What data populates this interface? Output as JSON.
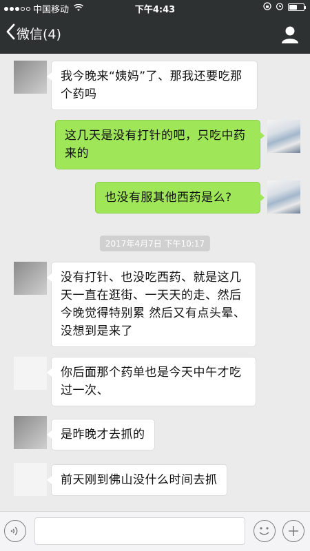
{
  "status_bar": {
    "carrier": "中国移动",
    "time": "下午4:43"
  },
  "nav": {
    "back_label": "微信(4)"
  },
  "messages": [
    {
      "side": "left",
      "avatar": "grey-avatar",
      "text": "我今晚来“姨妈”了、那我还要吃那个药吗"
    },
    {
      "side": "right",
      "text": "这几天是没有打针的吧，只吃中药来的"
    },
    {
      "side": "right",
      "text": "也没有服其他西药是么?"
    },
    {
      "side": "left",
      "avatar": "grey-avatar",
      "text": "没有打针、也没吃西药、就是这几天一直在逛街、一天天的走、然后今晚觉得特别累 然后又有点头晕、没想到是来了"
    },
    {
      "side": "left",
      "avatar": "pale-avatar",
      "text": "你后面那个药单也是今天中午才吃过一次、"
    },
    {
      "side": "left",
      "avatar": "grey-avatar",
      "text": "是昨晚才去抓的"
    },
    {
      "side": "left",
      "avatar": "pale-avatar",
      "text": "前天刚到佛山没什么时间去抓"
    }
  ],
  "timestamp": "2017年4月7日 下午10:17",
  "colors": {
    "nav_background": "#2e3132",
    "chat_background": "#ebebeb",
    "sent_bubble": "#9fe658",
    "received_bubble": "#ffffff"
  },
  "icons": [
    "back-chevron-icon",
    "profile-icon",
    "voice-icon",
    "emoji-icon",
    "plus-icon"
  ]
}
